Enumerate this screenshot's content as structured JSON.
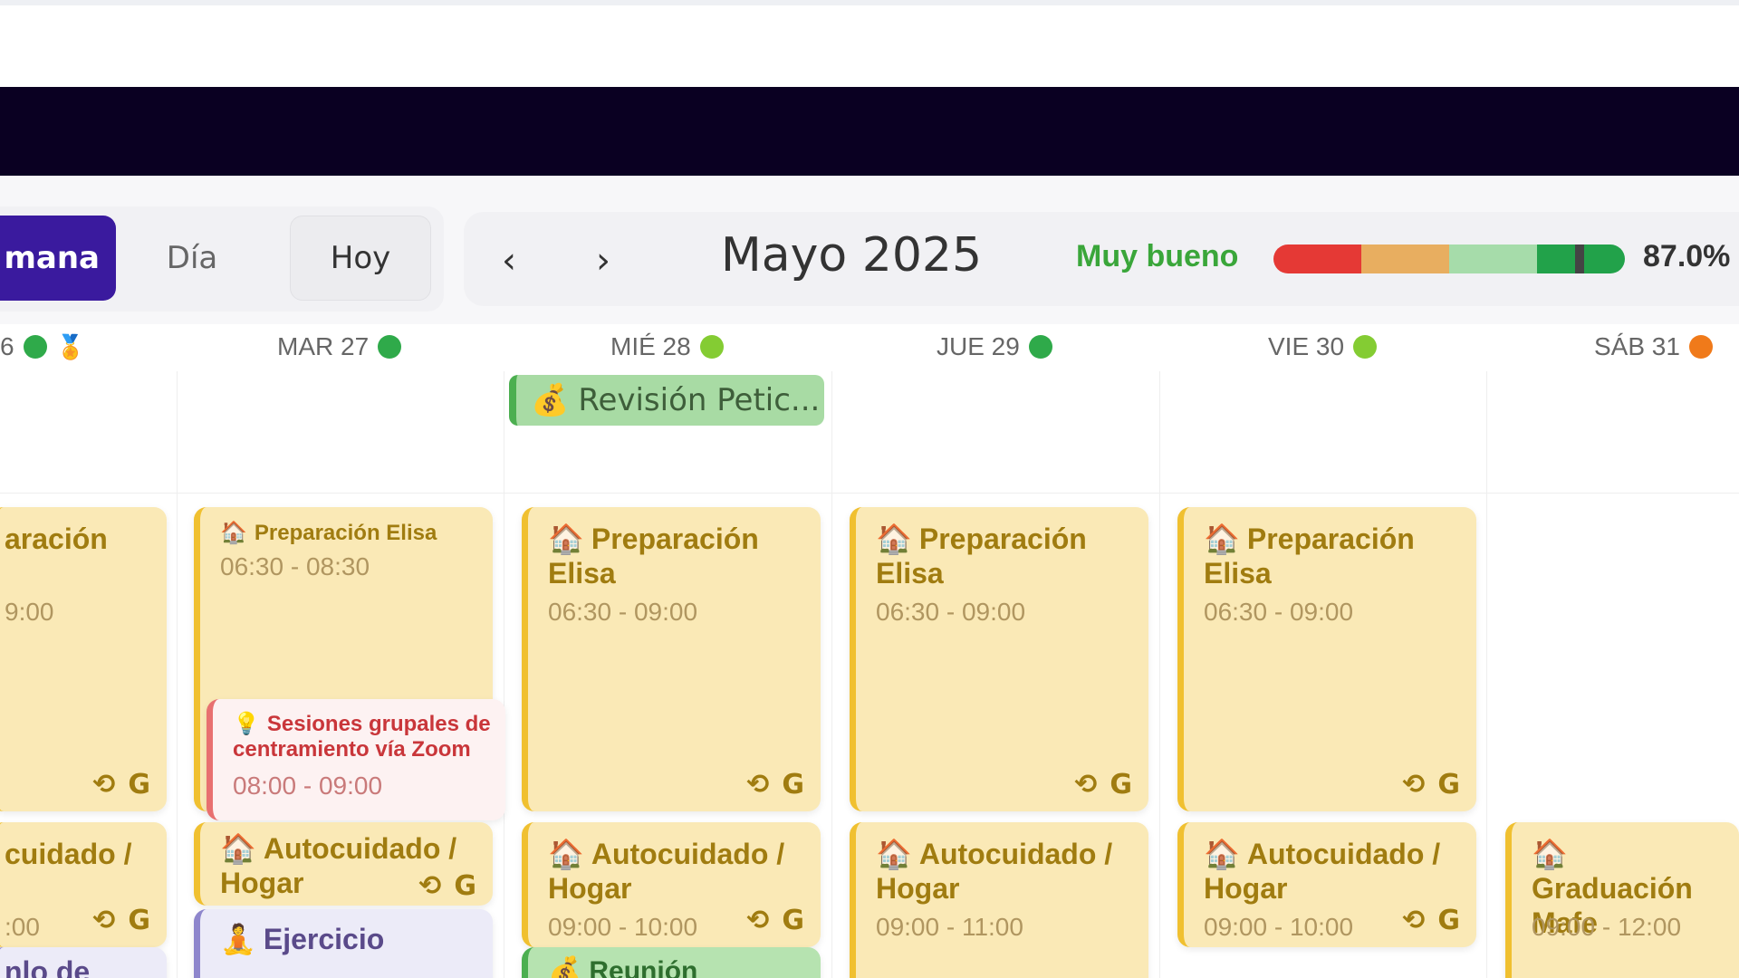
{
  "toolbar": {
    "view_week": "mana",
    "view_day": "Día",
    "today": "Hoy",
    "month": "Mayo 2025",
    "prev": "‹",
    "next": "›"
  },
  "rating": {
    "label": "Muy bueno",
    "value": "87.0%",
    "fraction": 0.87,
    "colors": [
      "#e53935",
      "#e8ae60",
      "#a6dcaa",
      "#22a24a"
    ]
  },
  "days": [
    {
      "label": "6",
      "dot_color": "#2faa4a",
      "badge": "medal-icon"
    },
    {
      "label": "MAR 27",
      "dot_color": "#2faa4a"
    },
    {
      "label": "MIÉ 28",
      "dot_color": "#84cc33"
    },
    {
      "label": "JUE 29",
      "dot_color": "#2faa4a"
    },
    {
      "label": "VIE 30",
      "dot_color": "#84cc33"
    },
    {
      "label": "SÁB 31",
      "dot_color": "#f07a1a"
    }
  ],
  "allday": {
    "title": "Revisión Petic...",
    "icon": "money-bag-icon"
  },
  "events": {
    "e0": {
      "title": "aración",
      "time": "9:00"
    },
    "e1": {
      "title": "Preparación Elisa",
      "time": "06:30 - 08:30"
    },
    "e2": {
      "title": "Sesiones grupales de centramiento vía Zoom",
      "time": "08:00 - 09:00"
    },
    "e3": {
      "title": "Preparación Elisa",
      "time": "06:30 - 09:00"
    },
    "e4": {
      "title": "Preparación Elisa",
      "time": "06:30 - 09:00"
    },
    "e5": {
      "title": "Preparación Elisa",
      "time": "06:30 - 09:00"
    },
    "e6": {
      "title": "cuidado /",
      "time": ":00"
    },
    "e7": {
      "title": "Autocuidado / Hogar",
      "time": ""
    },
    "e8": {
      "title": "Ejercicio",
      "time": ""
    },
    "e9": {
      "title": "Autocuidado / Hogar",
      "time": "09:00 - 10:00"
    },
    "e10": {
      "title": "Reunión",
      "time": ""
    },
    "e11": {
      "title": "Autocuidado / Hogar",
      "time": "09:00 - 11:00"
    },
    "e12": {
      "title": "Autocuidado / Hogar",
      "time": "09:00 - 10:00"
    },
    "e13": {
      "title": "Graduación Mafe",
      "time": "09:00 - 12:00"
    },
    "e14": {
      "title": "nlo de",
      "time": ""
    }
  },
  "icons": {
    "repeat": "repeat-icon",
    "google": "G"
  }
}
